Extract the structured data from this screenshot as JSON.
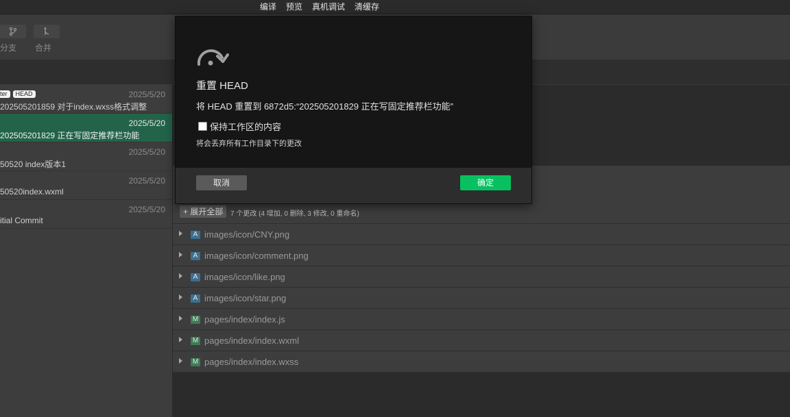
{
  "top_menu": [
    "编译",
    "预览",
    "真机调试",
    "清缓存"
  ],
  "toolbar": {
    "branch_label": "分支",
    "merge_label": "合并"
  },
  "commits": [
    {
      "date": "2025/5/20",
      "tags": [
        "ter",
        "HEAD"
      ],
      "message": "202505201859 对于index.wxss格式调整",
      "selected": false
    },
    {
      "date": "2025/5/20",
      "tags": [],
      "message": "202505201829 正在写固定推荐栏功能",
      "selected": true
    },
    {
      "date": "2025/5/20",
      "tags": [],
      "message": "50520 index版本1",
      "selected": false
    },
    {
      "date": "2025/5/20",
      "tags": [],
      "message": "50520index.wxml",
      "selected": false
    },
    {
      "date": "2025/5/20",
      "tags": [],
      "message": "itial Commit",
      "selected": false
    }
  ],
  "changes": {
    "expand_label": "+ 展开全部",
    "summary": "7 个更改 (4 增加, 0 删除, 3 修改, 0 重命名)",
    "files": [
      {
        "status": "A",
        "path": "images/icon/CNY.png"
      },
      {
        "status": "A",
        "path": "images/icon/comment.png"
      },
      {
        "status": "A",
        "path": "images/icon/like.png"
      },
      {
        "status": "A",
        "path": "images/icon/star.png"
      },
      {
        "status": "M",
        "path": "pages/index/index.js"
      },
      {
        "status": "M",
        "path": "pages/index/index.wxml"
      },
      {
        "status": "M",
        "path": "pages/index/index.wxss"
      }
    ]
  },
  "modal": {
    "icon": "reset-arrow-icon",
    "title": "重置 HEAD",
    "description": "将 HEAD 重置到 6872d5:“202505201829 正在写固定推荐栏功能”",
    "keep_label": "保持工作区的内容",
    "keep_checked": false,
    "warning": "将会丢弃所有工作目录下的更改",
    "cancel_label": "取消",
    "ok_label": "确定"
  },
  "colors": {
    "accent": "#07c160",
    "selected_row": "#22634a",
    "added_badge": "#3d6f8f",
    "modified_badge": "#3d7a56"
  }
}
